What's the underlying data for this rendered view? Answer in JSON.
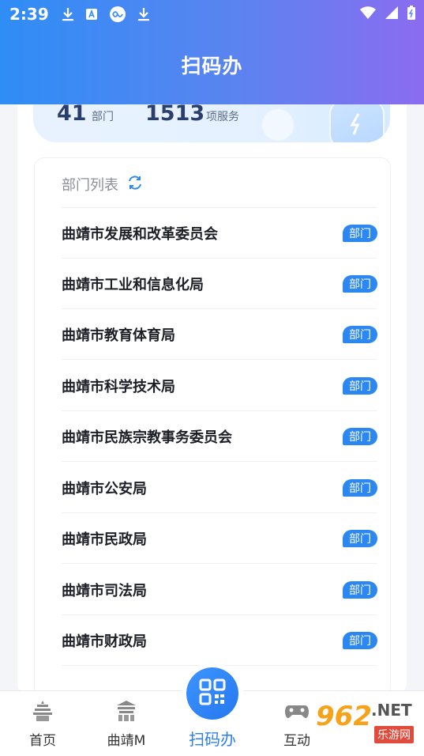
{
  "status_bar": {
    "time": "2:39"
  },
  "header": {
    "title": "扫码办"
  },
  "stats": {
    "dept_count": "41",
    "dept_label": "部门",
    "service_count": "1513",
    "service_label": "项服务"
  },
  "list": {
    "heading": "部门列表",
    "badge": "部门",
    "items": [
      "曲靖市发展和改革委员会",
      "曲靖市工业和信息化局",
      "曲靖市教育体育局",
      "曲靖市科学技术局",
      "曲靖市民族宗教事务委员会",
      "曲靖市公安局",
      "曲靖市民政局",
      "曲靖市司法局",
      "曲靖市财政局"
    ]
  },
  "nav": {
    "home": "首页",
    "qujing": "曲靖M",
    "scan": "扫码办",
    "interact": "互动"
  },
  "watermark": {
    "num": "962",
    "text": ".NET",
    "sub": "乐游网"
  },
  "colors": {
    "accent": "#2d87f1",
    "header_start": "#2f8df6",
    "header_end": "#8b6cf0"
  }
}
